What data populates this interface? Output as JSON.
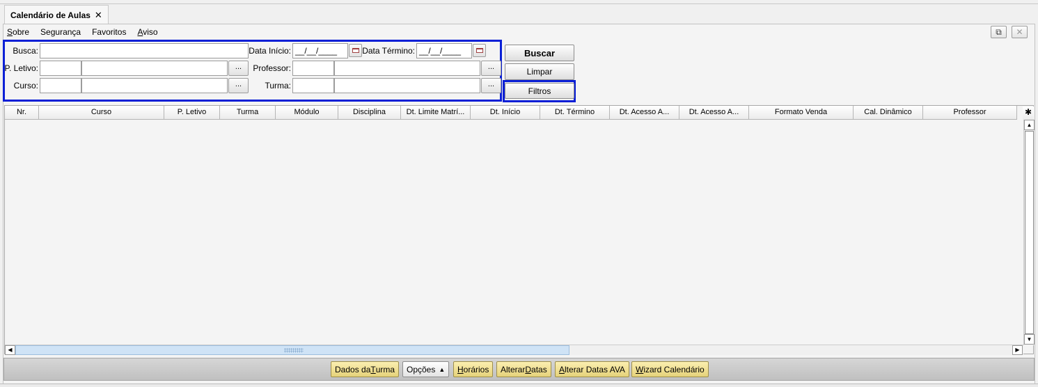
{
  "tab": {
    "title": "Calendário de Aulas",
    "close": "✕"
  },
  "menu": [
    {
      "pre": "",
      "u": "S",
      "post": "obre"
    },
    {
      "pre": "Segurança",
      "u": "",
      "post": ""
    },
    {
      "pre": "Favoritos",
      "u": "",
      "post": ""
    },
    {
      "pre": "",
      "u": "A",
      "post": "viso"
    }
  ],
  "window_buttons": {
    "popout": "⧉",
    "close": "✕"
  },
  "filters": {
    "busca_label": "Busca:",
    "busca_value": "",
    "data_inicio_label": "Data Início:",
    "data_inicio_value": "__/__/____",
    "data_termino_label": "Data Término:",
    "data_termino_value": "__/__/____",
    "p_letivo_label": "P. Letivo:",
    "professor_label": "Professor:",
    "curso_label": "Curso:",
    "turma_label": "Turma:",
    "lookup_button": "..."
  },
  "search_buttons": {
    "buscar": "Buscar",
    "limpar": "Limpar",
    "filtros": "Filtros"
  },
  "grid": {
    "columns": [
      "Nr.",
      "Curso",
      "P. Letivo",
      "Turma",
      "Módulo",
      "Disciplina",
      "Dt. Limite Matrí...",
      "Dt. Início",
      "Dt. Término",
      "Dt. Acesso A...",
      "Dt. Acesso A...",
      "Formato Venda",
      "Cal. Dinâmico",
      "Professor"
    ],
    "rows": []
  },
  "bottom_buttons": {
    "dados_turma": {
      "pre": "Dados da ",
      "u": "T",
      "post": "urma"
    },
    "opcoes": "Opções",
    "horarios": {
      "pre": "",
      "u": "H",
      "post": "orários"
    },
    "alterar_datas": {
      "pre": "Alterar ",
      "u": "D",
      "post": "atas"
    },
    "alterar_datas_ava": {
      "pre": "",
      "u": "A",
      "post": "lterar Datas AVA"
    },
    "wizard": {
      "pre": "",
      "u": "W",
      "post": "izard Calendário"
    }
  },
  "colors": {
    "highlight": "#0a1fd6",
    "action_button": "#e5d27a"
  }
}
